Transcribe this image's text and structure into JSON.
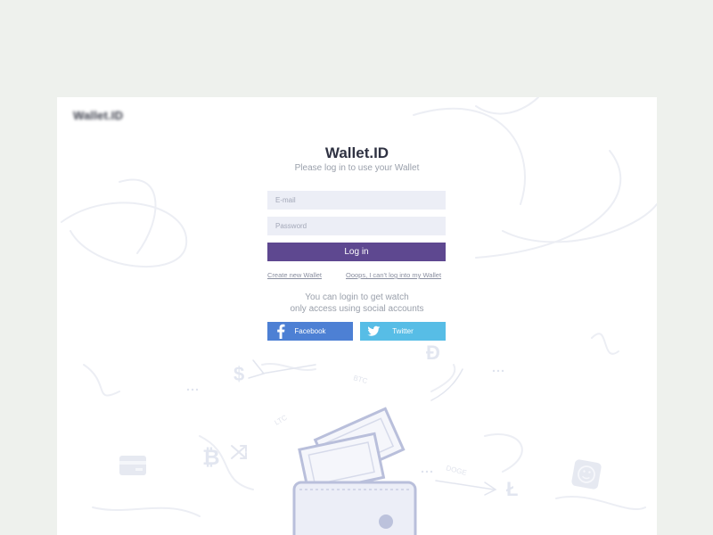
{
  "brand": {
    "logo_text": "Wallet.ID"
  },
  "login": {
    "title": "Wallet.ID",
    "subtitle": "Please log in to use your Wallet",
    "email_placeholder": "E-mail",
    "password_placeholder": "Password",
    "login_label": "Log in",
    "create_link": "Create new Wallet",
    "forgot_link": "Ooops, I can't log into my Wallet",
    "social_note_line1": "You can login to get watch",
    "social_note_line2": "only access using social accounts",
    "facebook_label": "Facebook",
    "twitter_label": "Twitter"
  },
  "illustration": {
    "labels": [
      "BTC",
      "LTC",
      "DOGE"
    ],
    "icons": [
      "dollar-icon",
      "bitcoin-icon",
      "dogecoin-icon",
      "litecoin-icon",
      "shuffle-icon",
      "card-icon",
      "smiley-icon",
      "wallet-icon",
      "banknote-icon"
    ]
  },
  "colors": {
    "page_bg": "#eef1ed",
    "primary": "#5e4890",
    "facebook": "#4d80d4",
    "twitter": "#57bde6",
    "input_bg": "#eceef6"
  }
}
